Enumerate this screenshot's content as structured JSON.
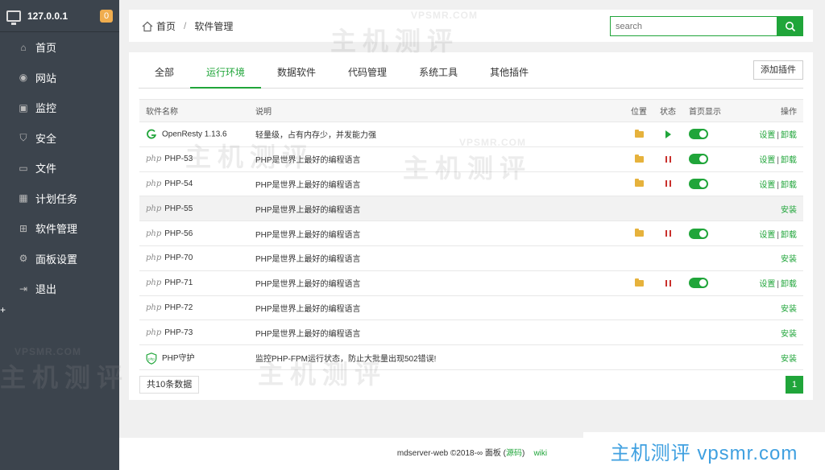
{
  "sidebar": {
    "ip": "127.0.0.1",
    "badge": "0",
    "items": [
      {
        "label": "首页",
        "icon": "home-icon"
      },
      {
        "label": "网站",
        "icon": "globe-icon"
      },
      {
        "label": "监控",
        "icon": "monitor-icon"
      },
      {
        "label": "安全",
        "icon": "shield-icon"
      },
      {
        "label": "文件",
        "icon": "folder-icon"
      },
      {
        "label": "计划任务",
        "icon": "calendar-icon"
      },
      {
        "label": "软件管理",
        "icon": "grid-icon"
      },
      {
        "label": "面板设置",
        "icon": "gear-icon"
      },
      {
        "label": "退出",
        "icon": "logout-icon"
      }
    ],
    "plus": "+"
  },
  "breadcrumb": {
    "home": "首页",
    "sep": "/",
    "current": "软件管理"
  },
  "search": {
    "placeholder": "search"
  },
  "tabs": [
    "全部",
    "运行环境",
    "数据软件",
    "代码管理",
    "系统工具",
    "其他插件"
  ],
  "add_button": "添加插件",
  "table": {
    "headers": {
      "name": "软件名称",
      "desc": "说明",
      "loc": "位置",
      "status": "状态",
      "home": "首页显示",
      "op": "操作"
    },
    "rows": [
      {
        "logo": "openresty",
        "name": "OpenResty 1.13.6",
        "desc": "轻量级，占有内存少，并发能力强",
        "folder": true,
        "status": "running",
        "toggle": true,
        "ops": [
          "设置",
          "卸载"
        ]
      },
      {
        "logo": "php",
        "logo_text": "php",
        "name": "PHP-53",
        "desc": "PHP是世界上最好的编程语言",
        "folder": true,
        "status": "stopped",
        "toggle": true,
        "ops": [
          "设置",
          "卸载"
        ]
      },
      {
        "logo": "php",
        "logo_text": "php",
        "name": "PHP-54",
        "desc": "PHP是世界上最好的编程语言",
        "folder": true,
        "status": "stopped",
        "toggle": true,
        "ops": [
          "设置",
          "卸载"
        ]
      },
      {
        "logo": "php",
        "logo_text": "php",
        "name": "PHP-55",
        "desc": "PHP是世界上最好的编程语言",
        "folder": false,
        "status": "",
        "toggle": false,
        "ops": [
          "安装"
        ],
        "highlight": true
      },
      {
        "logo": "php",
        "logo_text": "php",
        "name": "PHP-56",
        "desc": "PHP是世界上最好的编程语言",
        "folder": true,
        "status": "stopped",
        "toggle": true,
        "ops": [
          "设置",
          "卸载"
        ]
      },
      {
        "logo": "php",
        "logo_text": "php",
        "name": "PHP-70",
        "desc": "PHP是世界上最好的编程语言",
        "folder": false,
        "status": "",
        "toggle": false,
        "ops": [
          "安装"
        ]
      },
      {
        "logo": "php",
        "logo_text": "php",
        "name": "PHP-71",
        "desc": "PHP是世界上最好的编程语言",
        "folder": true,
        "status": "stopped",
        "toggle": true,
        "ops": [
          "设置",
          "卸载"
        ]
      },
      {
        "logo": "php",
        "logo_text": "php",
        "name": "PHP-72",
        "desc": "PHP是世界上最好的编程语言",
        "folder": false,
        "status": "",
        "toggle": false,
        "ops": [
          "安装"
        ]
      },
      {
        "logo": "php",
        "logo_text": "php",
        "name": "PHP-73",
        "desc": "PHP是世界上最好的编程语言",
        "folder": false,
        "status": "",
        "toggle": false,
        "ops": [
          "安装"
        ]
      },
      {
        "logo": "shield",
        "logo_text": "php",
        "name": "PHP守护",
        "desc": "监控PHP-FPM运行状态，防止大批量出现502错误!",
        "folder": false,
        "status": "",
        "toggle": false,
        "ops": [
          "安装"
        ]
      }
    ]
  },
  "pagination": {
    "count": "共10条数据",
    "page": "1"
  },
  "footer": {
    "text": "mdserver-web ©2018-∞ 面板 (",
    "source": "源码",
    "close": ")",
    "wiki": "wiki"
  },
  "brand": "主机测评 vpsmr.com",
  "watermark": {
    "big": "主机测评",
    "small": "VPSMR.COM"
  },
  "colors": {
    "accent": "#20a53a",
    "sidebar": "#3c444d",
    "stop": "#c9302c",
    "folder": "#e6b23c"
  }
}
